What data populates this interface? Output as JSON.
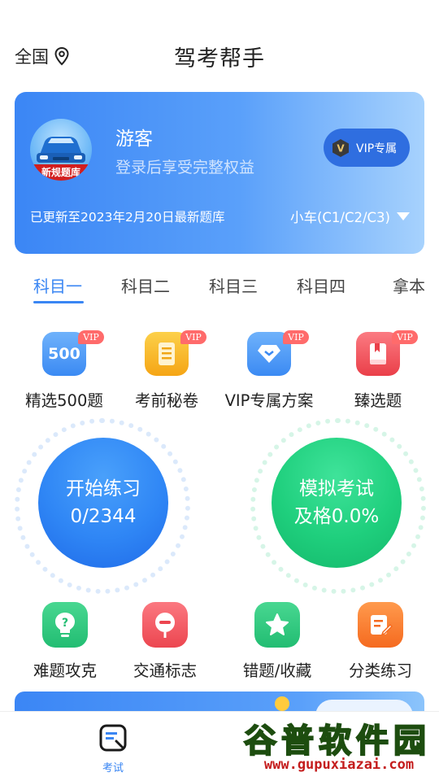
{
  "header": {
    "region": "全国",
    "title": "驾考帮手"
  },
  "user_card": {
    "avatar_banner": "新规题库",
    "name": "游客",
    "subtitle": "登录后享受完整权益",
    "vip_button": "VIP专属",
    "update_text": "已更新至2023年2月20日最新题库",
    "car_type": "小车(C1/C2/C3)"
  },
  "tabs": [
    "科目一",
    "科目二",
    "科目三",
    "科目四",
    "拿本"
  ],
  "features": [
    {
      "label": "精选500题",
      "icon": "500-icon",
      "badge": "VIP",
      "icon_text": "500",
      "color": "#4a97f6"
    },
    {
      "label": "考前秘卷",
      "icon": "scroll-icon",
      "badge": "VIP",
      "color": "#f7b21e"
    },
    {
      "label": "VIP专属方案",
      "icon": "diamond-icon",
      "badge": "VIP",
      "color": "#4a97f6"
    },
    {
      "label": "臻选题",
      "icon": "book-icon",
      "badge": "VIP",
      "color": "#f0525a"
    }
  ],
  "practice": {
    "line1": "开始练习",
    "line2": "0/2344",
    "color": "#2f86f5"
  },
  "exam": {
    "line1": "模拟考试",
    "line2": "及格0.0%",
    "color": "#1fcf7d"
  },
  "tools": [
    {
      "label": "难题攻克",
      "icon": "question-bulb-icon",
      "color": "#27c47a"
    },
    {
      "label": "交通标志",
      "icon": "traffic-sign-icon",
      "color": "#f2545b"
    },
    {
      "label": "错题/收藏",
      "icon": "star-icon",
      "color": "#27c47a"
    },
    {
      "label": "分类练习",
      "icon": "edit-note-icon",
      "color": "#f77a2a"
    }
  ],
  "bottom_nav": {
    "exam_label": "考试"
  },
  "watermark": {
    "title": "谷普软件园",
    "url": "www.gupuxiazai.com"
  }
}
